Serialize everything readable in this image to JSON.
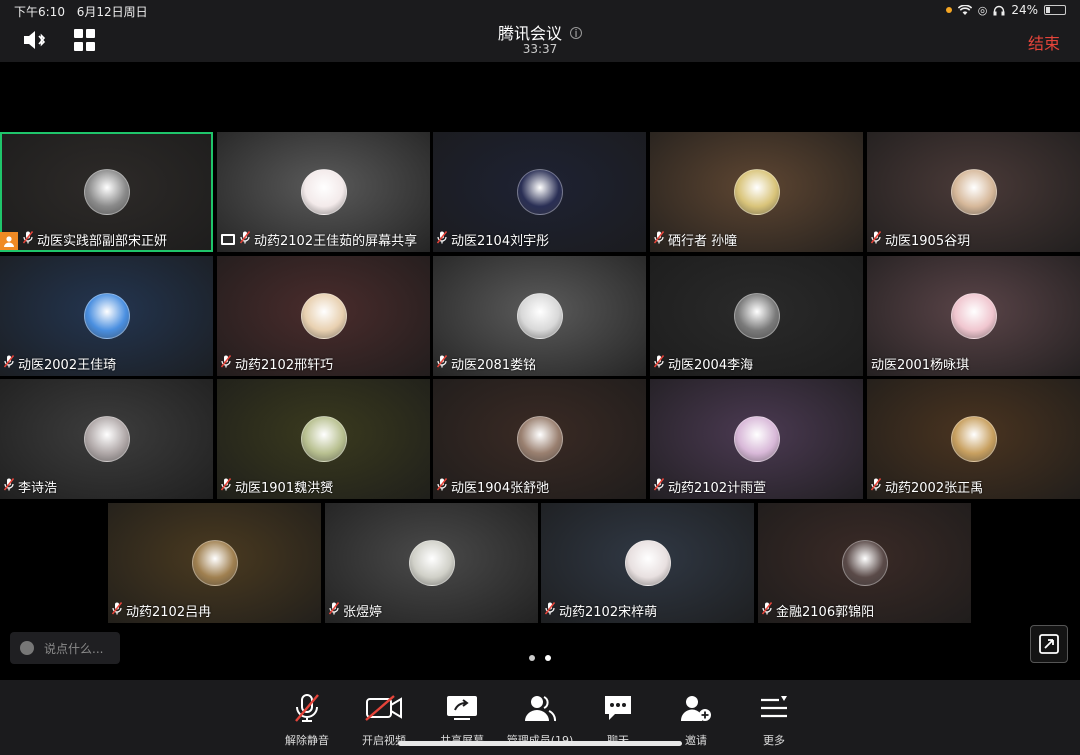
{
  "status_bar": {
    "time": "下午6:10",
    "date": "6月12日周日",
    "battery": "24%",
    "battery_level": 0.24
  },
  "header": {
    "title": "腾讯会议",
    "timer": "33:37",
    "end_label": "结束",
    "info_icon": "info-icon"
  },
  "participants": [
    {
      "name": "动医实践部副部宋正妍",
      "host": true,
      "mic": "muted",
      "active": true,
      "bg": "#2d2a28",
      "av": "#8a8a8a"
    },
    {
      "name": "动药2102王佳茹的屏幕共享",
      "screen": true,
      "mic": "muted",
      "bg": "#5a5a5a",
      "av": "#f3eaea"
    },
    {
      "name": "动医2104刘宇彤",
      "mic": "muted",
      "bg": "#1e2233",
      "av": "#2a2f55"
    },
    {
      "name": "硒行者 孙曈",
      "mic": "muted",
      "bg": "#5e4632",
      "av": "#d9c47a"
    },
    {
      "name": "动医1905谷玥",
      "mic": "muted",
      "bg": "#4a3a38",
      "av": "#d6b89a"
    },
    {
      "name": "动医2002王佳琦",
      "mic": "muted",
      "bg": "#233550",
      "av": "#4a8fe0"
    },
    {
      "name": "动药2102邢轩巧",
      "mic": "muted",
      "bg": "#4a2c2c",
      "av": "#e8d0b0"
    },
    {
      "name": "动医2081娄铭",
      "mic": "muted",
      "bg": "#5b5b5b",
      "av": "#d8d8d8"
    },
    {
      "name": "动医2004李海",
      "mic": "muted",
      "bg": "#2a2a2a",
      "av": "#7a7a7a"
    },
    {
      "name": "动医2001杨咏琪",
      "mic": "none",
      "bg": "#5a4448",
      "av": "#f0c6cf"
    },
    {
      "name": "李诗浩",
      "mic": "muted",
      "bg": "#3d3d3d",
      "av": "#b0a8a8"
    },
    {
      "name": "动医1901魏洪赟",
      "mic": "muted",
      "bg": "#3a3a1e",
      "av": "#b8c090"
    },
    {
      "name": "动医1904张舒弛",
      "mic": "muted",
      "bg": "#3a2a24",
      "av": "#9a8070"
    },
    {
      "name": "动药2102计雨萱",
      "mic": "muted",
      "bg": "#4b3a52",
      "av": "#d8b8d8"
    },
    {
      "name": "动药2002张正禹",
      "mic": "muted",
      "bg": "#4a3420",
      "av": "#c8a060"
    },
    {
      "name": "动药2102吕冉",
      "mic": "muted",
      "bg": "#4a3a20",
      "av": "#a08050"
    },
    {
      "name": "张煜婷",
      "mic": "muted",
      "bg": "#4a4a4a",
      "av": "#d0d0c8"
    },
    {
      "name": "动药2102宋梓萌",
      "mic": "muted",
      "bg": "#303844",
      "av": "#e8e0e0"
    },
    {
      "name": "金融2106郭锦阳",
      "mic": "muted",
      "bg": "#3a2a26",
      "av": "#5a4a48"
    }
  ],
  "chat": {
    "placeholder": "说点什么..."
  },
  "toolbar": [
    {
      "id": "unmute",
      "label": "解除静音",
      "icon": "mic-muted-icon"
    },
    {
      "id": "video",
      "label": "开启视频",
      "icon": "video-off-icon"
    },
    {
      "id": "share",
      "label": "共享屏幕",
      "icon": "share-screen-icon"
    },
    {
      "id": "members",
      "label": "管理成员(19)",
      "icon": "members-icon"
    },
    {
      "id": "chat",
      "label": "聊天",
      "icon": "chat-icon"
    },
    {
      "id": "invite",
      "label": "邀请",
      "icon": "invite-icon"
    },
    {
      "id": "more",
      "label": "更多",
      "icon": "more-icon"
    }
  ],
  "colors": {
    "end": "#e5443a",
    "active_border": "#1fc56b",
    "host_badge": "#f08a24"
  }
}
